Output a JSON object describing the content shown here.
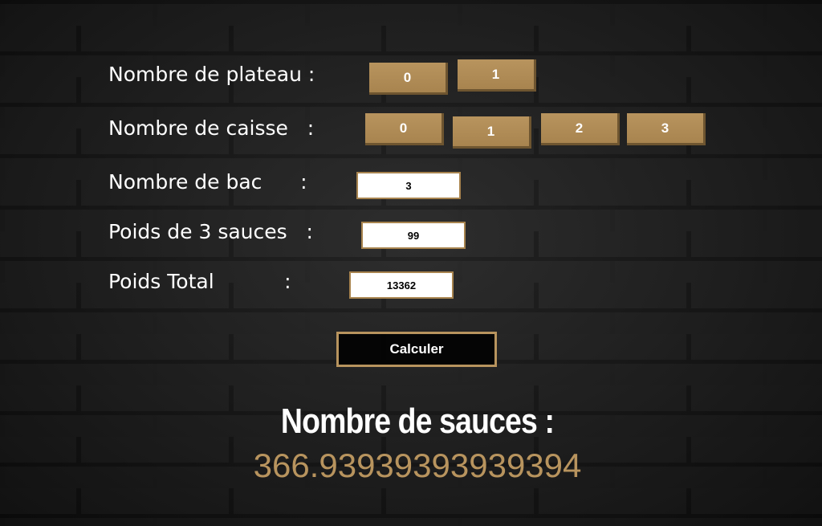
{
  "form": {
    "plateau": {
      "label": "Nombre de plateau :",
      "options": [
        "0",
        "1"
      ]
    },
    "caisse": {
      "label": "Nombre de caisse   :",
      "options": [
        "0",
        "1",
        "2",
        "3"
      ]
    },
    "bac": {
      "label": "Nombre de bac      :",
      "value": "3"
    },
    "poids_sauces": {
      "label": "Poids de 3 sauces   :",
      "value": "99"
    },
    "poids_total": {
      "label": "Poids Total           :",
      "value": "13362"
    },
    "calculate_label": "Calculer"
  },
  "result": {
    "title": "Nombre de sauces :",
    "value": "366.93939393939394"
  },
  "colors": {
    "accent": "#b8945e",
    "text": "#ffffff",
    "background": "#262626"
  }
}
